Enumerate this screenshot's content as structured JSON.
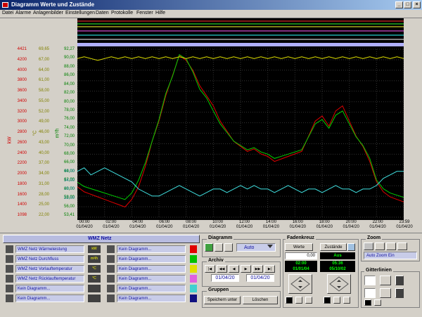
{
  "window": {
    "title": "Diagramm Werte und Zustände",
    "min": "_",
    "max": "□",
    "close": "×"
  },
  "menu": [
    "Datei",
    "Alarme",
    "Anlagenbilder",
    "Einstellungen",
    "Daten",
    "Protokolle",
    "Fenster",
    "Hilfe"
  ],
  "axes": {
    "kw": {
      "label": "kW",
      "color": "#d00000",
      "ticks": [
        "4421",
        "4200",
        "4000",
        "3800",
        "3600",
        "3400",
        "3200",
        "3000",
        "2800",
        "2600",
        "2400",
        "2200",
        "2000",
        "1800",
        "1600",
        "1400",
        "1098"
      ]
    },
    "m3h": {
      "label": "m³/h",
      "color": "#008000",
      "ticks": [
        "92,27",
        "90,00",
        "88,00",
        "86,00",
        "84,00",
        "82,00",
        "80,00",
        "78,00",
        "76,00",
        "74,00",
        "72,00",
        "70,00",
        "68,00",
        "66,00",
        "64,00",
        "62,00",
        "60,00",
        "58,00",
        "56,00",
        "53,41"
      ]
    },
    "degc": {
      "label": "°C",
      "color": "#808000",
      "ticks": [
        "69,65",
        "67,00",
        "64,00",
        "61,00",
        "58,00",
        "55,00",
        "52,00",
        "49,00",
        "46,00",
        "43,00",
        "40,00",
        "37,00",
        "34,00",
        "31,00",
        "28,00",
        "25,00",
        "22,00"
      ]
    },
    "rl": {
      "label": "°C",
      "color": "#008080",
      "ticks": [
        "40,00",
        "34,00",
        "28,00",
        "22,00"
      ]
    }
  },
  "xaxis": {
    "times": [
      "00:00",
      "02:00",
      "04:00",
      "06:00",
      "08:00",
      "10:00",
      "12:00",
      "14:00",
      "16:00",
      "18:00",
      "20:00",
      "22:00",
      "23:59"
    ],
    "date": "01/04/20"
  },
  "chart_data": {
    "type": "line",
    "x": [
      "00:00",
      "00:30",
      "01:00",
      "01:30",
      "02:00",
      "02:30",
      "03:00",
      "03:30",
      "04:00",
      "04:30",
      "05:00",
      "05:30",
      "06:00",
      "06:30",
      "07:00",
      "07:30",
      "08:00",
      "08:30",
      "09:00",
      "09:30",
      "10:00",
      "10:30",
      "11:00",
      "11:30",
      "12:00",
      "12:30",
      "13:00",
      "13:30",
      "14:00",
      "14:30",
      "15:00",
      "15:30",
      "16:00",
      "16:30",
      "17:00",
      "17:30",
      "18:00",
      "18:30",
      "19:00",
      "19:30",
      "20:00",
      "20:30",
      "21:00",
      "21:30",
      "22:00",
      "22:30",
      "23:00",
      "23:30",
      "23:59"
    ],
    "series": [
      {
        "name": "WMZ Netz Wärmeleistung",
        "color": "#e00000",
        "axis": "kW",
        "values": [
          1700,
          1600,
          1550,
          1500,
          1450,
          1400,
          1350,
          1300,
          1450,
          1700,
          2100,
          2600,
          3000,
          3500,
          3900,
          4300,
          4200,
          4000,
          3700,
          3500,
          3300,
          3000,
          2800,
          2600,
          2500,
          2400,
          2450,
          2350,
          2300,
          2200,
          2250,
          2300,
          2350,
          2400,
          2700,
          3000,
          3100,
          2900,
          3200,
          3300,
          3000,
          2700,
          2500,
          2200,
          1800,
          1600,
          1500,
          1450,
          1400
        ]
      },
      {
        "name": "WMZ Netz Durchfluss",
        "color": "#00d000",
        "axis": "m³/h",
        "values": [
          61.5,
          60.5,
          60,
          59.5,
          59,
          58.5,
          58,
          57.5,
          59,
          62,
          66,
          71,
          76,
          82,
          86,
          91,
          90,
          87,
          83,
          81,
          78,
          75,
          73,
          71,
          70,
          69,
          69.5,
          68.5,
          68,
          67,
          67.5,
          68,
          68.5,
          69,
          72,
          75,
          76,
          74,
          77,
          78,
          75,
          72,
          70,
          67,
          62,
          60,
          59,
          58.5,
          58
        ]
      },
      {
        "name": "WMZ Netz Vorlauftemperatur",
        "color": "#e0e000",
        "axis": "°C",
        "values": [
          67,
          67.5,
          67,
          66.5,
          67,
          67.5,
          67,
          67.5,
          67,
          67.5,
          67,
          67.5,
          67,
          67.5,
          67,
          67.5,
          67,
          67.5,
          67,
          67.5,
          67,
          67.5,
          67,
          67.5,
          67,
          67.5,
          67,
          67.5,
          67,
          67.5,
          67,
          67.5,
          67,
          67.5,
          67,
          67.5,
          67,
          67.5,
          67,
          67.5,
          67,
          67.5,
          67,
          67.5,
          67,
          67.5,
          67,
          67.5,
          67
        ]
      },
      {
        "name": "WMZ Netz Rücklauftemperatur",
        "color": "#40e0e0",
        "axis": "°C",
        "values": [
          35,
          36,
          34,
          35,
          36,
          35,
          34,
          33,
          32,
          30,
          29,
          28,
          28,
          29,
          30,
          31,
          30,
          29,
          28,
          29,
          30,
          30,
          29,
          30,
          31,
          30,
          31,
          30,
          30,
          29,
          30,
          31,
          30,
          29,
          30,
          30,
          29,
          30,
          31,
          30,
          30,
          29,
          30,
          30,
          31,
          33,
          34,
          35,
          35
        ]
      }
    ]
  },
  "channels": {
    "header": "WMZ Netz",
    "left": [
      {
        "name": "WMZ Netz Wärmeleistung",
        "unit": "kW",
        "color": "#e00000"
      },
      {
        "name": "WMZ Netz Durchfluss",
        "unit": "m³/h",
        "color": "#00c000"
      },
      {
        "name": "WMZ Netz Vorlauftemperatur",
        "unit": "°C",
        "color": "#e0e000"
      },
      {
        "name": "WMZ Netz Rücklauftemperatur",
        "unit": "°C",
        "color": "#40d0d0"
      },
      {
        "name": "Kein Diagramm...",
        "unit": "",
        "color": "#606060"
      },
      {
        "name": "Kein Diagramm...",
        "unit": "",
        "color": "#606060"
      }
    ],
    "right": [
      {
        "name": "Kein Diagramm...",
        "color": "#e00000"
      },
      {
        "name": "Kein Diagramm...",
        "color": "#00c000"
      },
      {
        "name": "Kein Diagramm...",
        "color": "#e0e000"
      },
      {
        "name": "Kein Diagramm...",
        "color": "#e060e0"
      },
      {
        "name": "Kein Diagramm...",
        "color": "#40d0d0"
      },
      {
        "name": "Kein Diagramm...",
        "color": "#101080"
      }
    ]
  },
  "diagramm": {
    "title": "Diagramm",
    "mode": "Auto"
  },
  "archiv": {
    "title": "Archiv",
    "date_from": "01/04/20",
    "date_to": "01/04/20"
  },
  "gruppen": {
    "title": "Gruppen",
    "save": "Speichern unter",
    "delete": "Löschen"
  },
  "fadenkreuz": {
    "title": "Fadenkreuz",
    "werte": "Werte",
    "zustaende": "Zustände",
    "value": "0,00",
    "status": "Aus",
    "time1": "02:00",
    "date1": "01/01/04",
    "time2": "05:36",
    "date2": "05/10/02"
  },
  "zoom": {
    "title": "Zoom",
    "mode": "Auto Zoom Ein"
  },
  "gitterlinien": {
    "title": "Gitterlinien"
  }
}
